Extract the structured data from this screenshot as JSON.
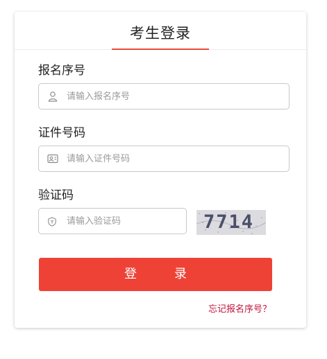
{
  "title": "考生登录",
  "fields": {
    "regno": {
      "label": "报名序号",
      "placeholder": "请输入报名序号",
      "value": "",
      "icon": "user-icon"
    },
    "idno": {
      "label": "证件号码",
      "placeholder": "请输入证件号码",
      "value": "",
      "icon": "id-card-icon"
    },
    "captcha": {
      "label": "验证码",
      "placeholder": "请输入验证码",
      "value": "",
      "icon": "shield-icon"
    }
  },
  "captcha_image_text": "7714",
  "login_button": "登　录",
  "forgot_link": "忘记报名序号？",
  "colors": {
    "accent": "#e84a3a",
    "button": "#ee4236",
    "link": "#c0143c"
  }
}
